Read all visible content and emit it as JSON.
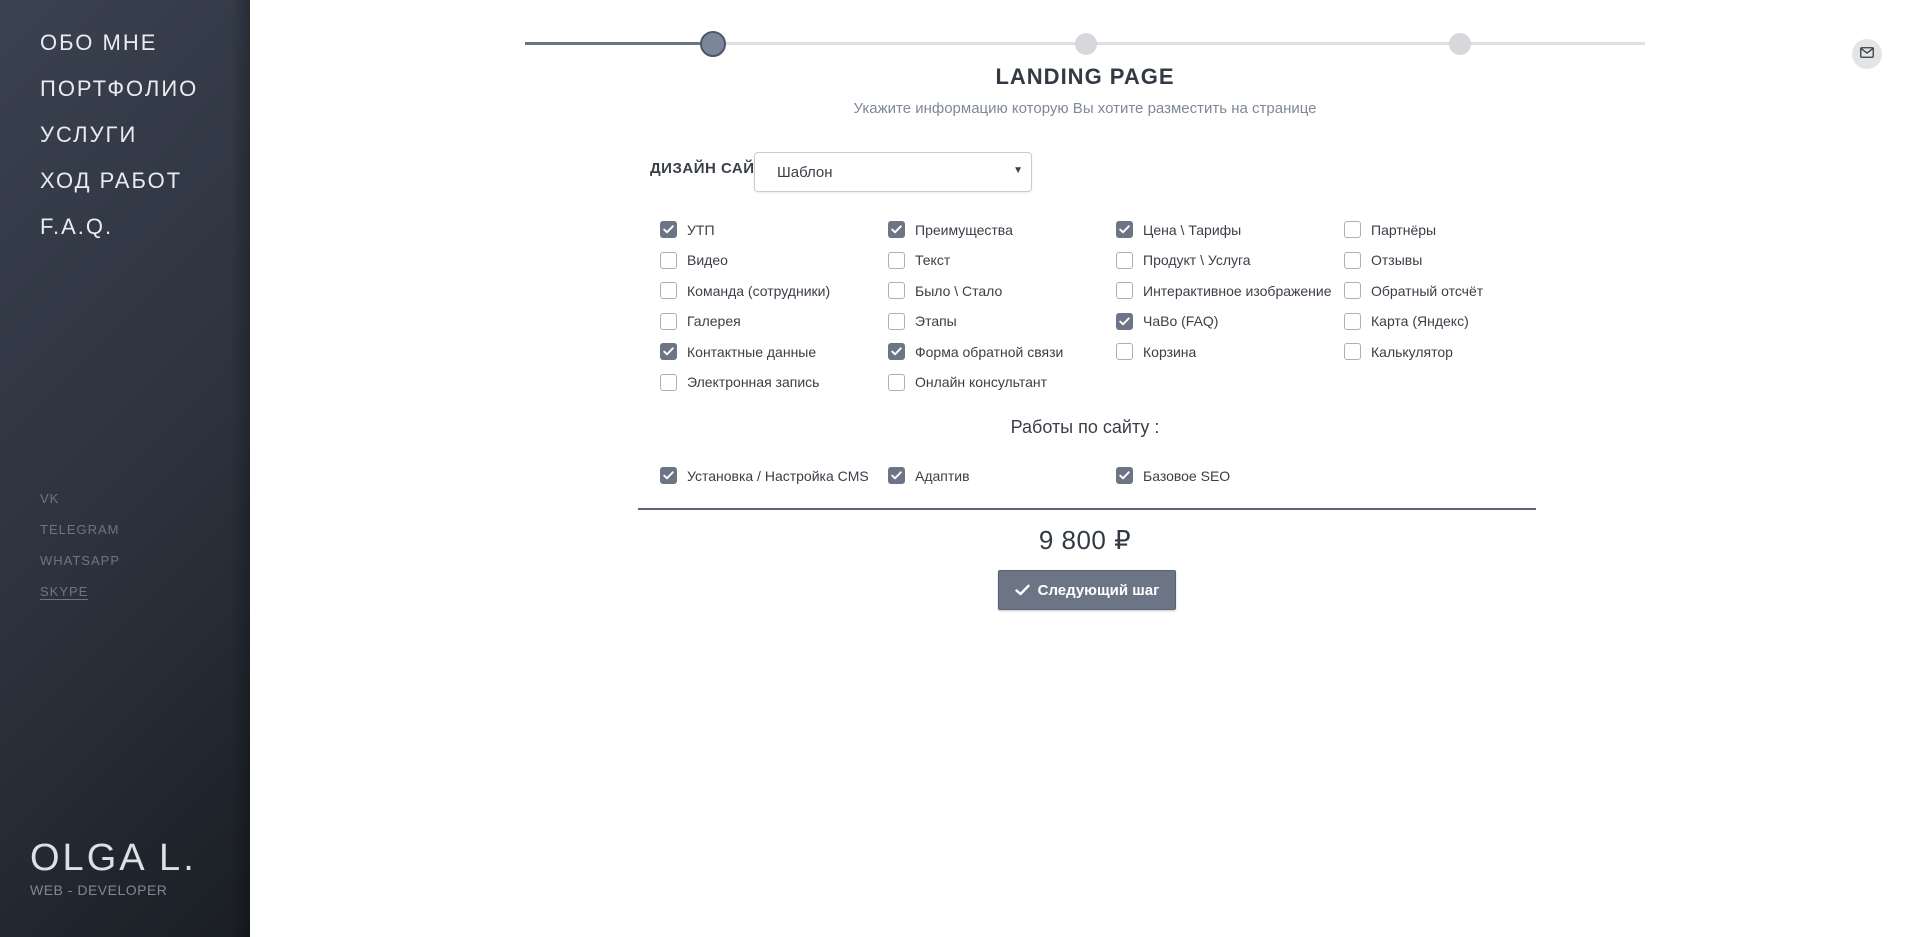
{
  "sidebar": {
    "nav": [
      "ОБО МНЕ",
      "ПОРТФОЛИО",
      "УСЛУГИ",
      "ХОД РАБОТ",
      "F.A.Q."
    ],
    "social": [
      "VK",
      "TELEGRAM",
      "WHATSAPP",
      "SKYPE"
    ],
    "brand_name": "OLGA L.",
    "brand_sub": "WEB - DEVELOPER"
  },
  "stepper": {
    "steps": 3,
    "current": 1,
    "progress": 0.17
  },
  "header": {
    "title": "LANDING PAGE",
    "subtitle": "Укажите информацию которую Вы хотите разместить на странице"
  },
  "design": {
    "label": "ДИЗАЙН САЙТА",
    "value": "Шаблон"
  },
  "blocks": {
    "rows": [
      [
        {
          "label": "УТП",
          "checked": true
        },
        {
          "label": "Преимущества",
          "checked": true
        },
        {
          "label": "Цена \\ Тарифы",
          "checked": true
        },
        {
          "label": "Партнёры",
          "checked": false
        }
      ],
      [
        {
          "label": "Видео",
          "checked": false
        },
        {
          "label": "Текст",
          "checked": false
        },
        {
          "label": "Продукт \\ Услуга",
          "checked": false
        },
        {
          "label": "Отзывы",
          "checked": false
        }
      ],
      [
        {
          "label": "Команда (сотрудники)",
          "checked": false
        },
        {
          "label": "Было \\ Стало",
          "checked": false
        },
        {
          "label": "Интерактивное изображение",
          "checked": false
        },
        {
          "label": "Обратный отсчёт",
          "checked": false
        }
      ],
      [
        {
          "label": "Галерея",
          "checked": false
        },
        {
          "label": "Этапы",
          "checked": false
        },
        {
          "label": "ЧаВо (FAQ)",
          "checked": true
        },
        {
          "label": "Карта (Яндекс)",
          "checked": false
        }
      ],
      [
        {
          "label": "Контактные данные",
          "checked": true
        },
        {
          "label": "Форма обратной связи",
          "checked": true
        },
        {
          "label": "Корзина",
          "checked": false
        },
        {
          "label": "Калькулятор",
          "checked": false
        }
      ],
      [
        {
          "label": "Электронная запись",
          "checked": false
        },
        {
          "label": "Онлайн консультант",
          "checked": false
        }
      ]
    ]
  },
  "works": {
    "title": "Работы по сайту :",
    "items": [
      {
        "label": "Установка / Настройка CMS",
        "checked": true
      },
      {
        "label": "Адаптив",
        "checked": true
      },
      {
        "label": "Базовое SEO",
        "checked": true
      }
    ]
  },
  "price": "9 800 ₽",
  "next_button": "Следующий шаг",
  "colors": {
    "accent": "#6c7585",
    "sidebar": "#2c323d"
  },
  "icons": {
    "mail": "envelope-icon",
    "check": "check-icon"
  }
}
